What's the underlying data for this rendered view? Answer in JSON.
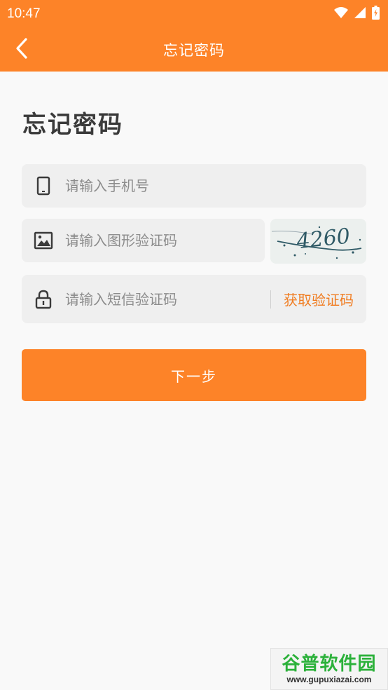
{
  "status_bar": {
    "time": "10:47"
  },
  "app_bar": {
    "title": "忘记密码"
  },
  "page": {
    "heading": "忘记密码"
  },
  "form": {
    "phone_placeholder": "请输入手机号",
    "image_code_placeholder": "请输入图形验证码",
    "sms_code_placeholder": "请输入短信验证码",
    "get_code_label": "获取验证码",
    "captcha_text": "4260"
  },
  "actions": {
    "next_label": "下一步"
  },
  "watermark": {
    "brand": "谷普软件园",
    "url": "www.gupuxiazai.com"
  },
  "colors": {
    "accent": "#fd8328",
    "field_bg": "#efefef",
    "link": "#f07d22"
  }
}
